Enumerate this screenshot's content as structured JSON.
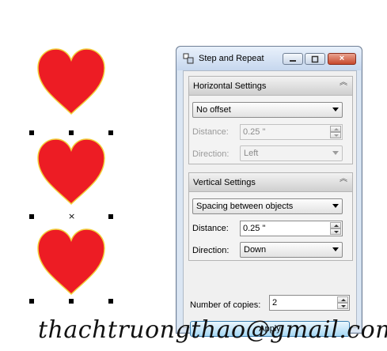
{
  "window": {
    "title": "Step and Repeat",
    "close_glyph": "×"
  },
  "horizontal": {
    "header": "Horizontal Settings",
    "mode_value": "No offset",
    "distance_label": "Distance:",
    "distance_value": "0.25 \"",
    "direction_label": "Direction:",
    "direction_value": "Left"
  },
  "vertical": {
    "header": "Vertical Settings",
    "mode_value": "Spacing between objects",
    "distance_label": "Distance:",
    "distance_value": "0.25 \"",
    "direction_label": "Direction:",
    "direction_value": "Down"
  },
  "copies": {
    "label": "Number of copies:",
    "value": "2"
  },
  "apply_label": "Apply",
  "watermark": "thachtruongthao@gmail.com",
  "canvas": {
    "center_marker": "×",
    "heart_fill": "#ed1c24",
    "heart_outline": "#f2d03a"
  },
  "colors": {
    "window_frame": "#dbe6f3",
    "apply_button": "#a7d9f5"
  },
  "icons": {
    "collapse": "double-chevron-up-icon",
    "window_icon": "step-repeat-icon"
  }
}
